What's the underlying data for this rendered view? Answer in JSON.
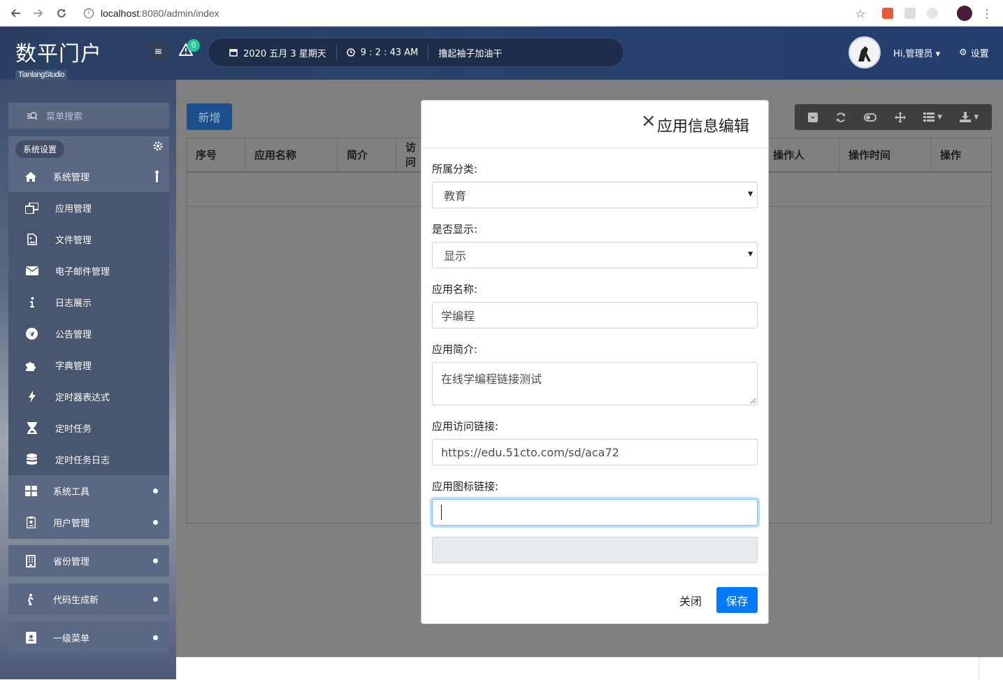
{
  "browser": {
    "url_host": "localhost",
    "url_path": ":8080/admin/index"
  },
  "header": {
    "brand": "数平门户",
    "subbrand": "TianlangStudio",
    "alert_count": "0",
    "date": "2020 五月 3 星期天",
    "time": "9 : 2 : 43 AM",
    "slogan": "撸起袖子加油干",
    "user": "Hi,管理员",
    "settings": "设置"
  },
  "sidebar": {
    "search_placeholder": "菜单搜索",
    "section": "系统设置",
    "system_mgmt": "系统管理",
    "sub_items": [
      {
        "label": "应用管理",
        "icon": "window-restore-icon"
      },
      {
        "label": "文件管理",
        "icon": "file-image-icon"
      },
      {
        "label": "电子邮件管理",
        "icon": "envelope-icon"
      },
      {
        "label": "日志展示",
        "icon": "info-icon"
      },
      {
        "label": "公告管理",
        "icon": "telegram-icon"
      },
      {
        "label": "字典管理",
        "icon": "puzzle-icon"
      },
      {
        "label": "定时器表达式",
        "icon": "bolt-icon"
      },
      {
        "label": "定时任务",
        "icon": "hourglass-icon"
      },
      {
        "label": "定时任务日志",
        "icon": "database-icon"
      }
    ],
    "tools": "系统工具",
    "users": "用户管理",
    "province": "省份管理",
    "codegen": "代码生成新",
    "menu1": "一级菜单"
  },
  "content": {
    "add_button": "新增",
    "columns": [
      "序号",
      "应用名称",
      "简介",
      "访问",
      "操作人",
      "操作时间",
      "操作"
    ]
  },
  "modal": {
    "title": "应用信息编辑",
    "category_label": "所属分类:",
    "category_value": "教育",
    "display_label": "是否显示:",
    "display_value": "显示",
    "name_label": "应用名称:",
    "name_value": "学编程",
    "desc_label": "应用简介:",
    "desc_value": "在线学编程链接测试",
    "url_label": "应用访问链接:",
    "url_value": "https://edu.51cto.com/sd/aca72",
    "icon_label": "应用图标链接:",
    "icon_value": "",
    "close": "关闭",
    "save": "保存"
  },
  "colors": {
    "primary": "#007bff",
    "header_bg": "#2a3f63",
    "badge": "#20c997"
  }
}
